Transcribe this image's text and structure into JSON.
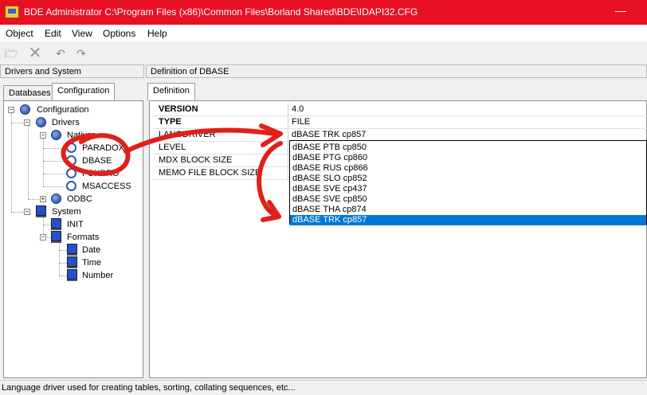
{
  "window": {
    "title": "BDE Administrator  C:\\Program Files (x86)\\Common Files\\Borland Shared\\BDE\\IDAPI32.CFG",
    "min_glyph": "—"
  },
  "menu": [
    "Object",
    "Edit",
    "View",
    "Options",
    "Help"
  ],
  "toolbar": {
    "open": "🗁",
    "delete": "✕",
    "undo": "↶",
    "redo": "↷"
  },
  "left_header": "Drivers and System",
  "right_header": "Definition of DBASE",
  "left_tabs": [
    "Databases",
    "Configuration"
  ],
  "right_tab": "Definition",
  "tree": {
    "configuration": "Configuration",
    "drivers": "Drivers",
    "native": "Native",
    "paradox": "PARADOX",
    "dbase": "DBASE",
    "foxpro": "FOXPRO",
    "msaccess": "MSACCESS",
    "odbc": "ODBC",
    "system": "System",
    "init": "INIT",
    "formats": "Formats",
    "date": "Date",
    "time": "Time",
    "number": "Number"
  },
  "properties": [
    {
      "name": "VERSION",
      "value": "4.0"
    },
    {
      "name": "TYPE",
      "value": "FILE"
    },
    {
      "name": "LANGDRIVER",
      "value": "dBASE TRK cp857"
    },
    {
      "name": "LEVEL",
      "value": ""
    },
    {
      "name": "MDX BLOCK SIZE",
      "value": ""
    },
    {
      "name": "MEMO FILE BLOCK SIZE",
      "value": ""
    }
  ],
  "dropdown_options": [
    "dBASE PTB cp850",
    "dBASE PTG cp860",
    "dBASE RUS cp866",
    "dBASE SLO cp852",
    "dBASE SVE cp437",
    "dBASE SVE cp850",
    "dBASE THA cp874",
    "dBASE TRK cp857"
  ],
  "selected_option": "dBASE TRK cp857",
  "status": "Language driver used for creating tables, sorting, collating sequences, etc...",
  "colors": {
    "titlebar": "#e81123",
    "selection": "#0078d7",
    "annotation": "#e0201b"
  }
}
